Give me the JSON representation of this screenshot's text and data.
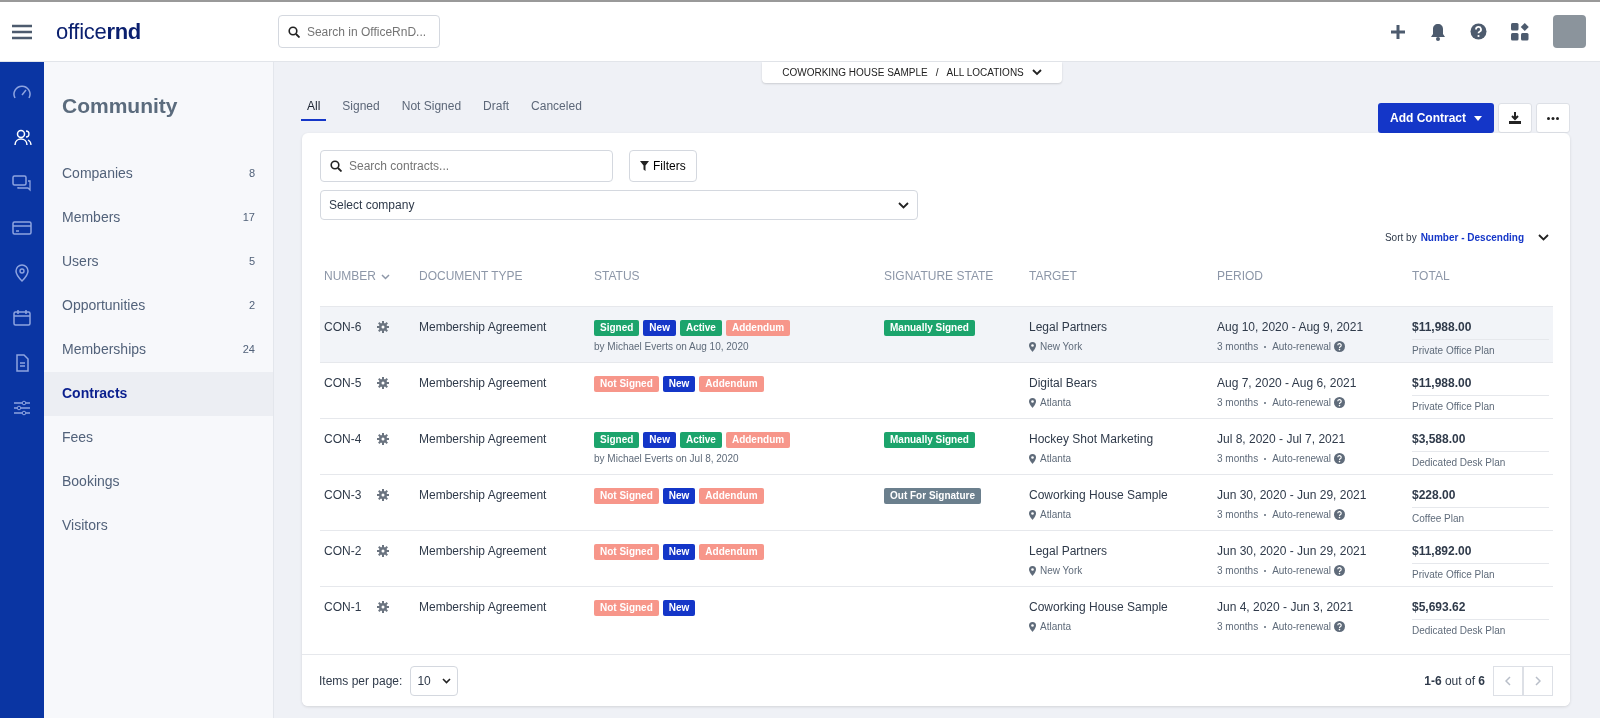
{
  "topbar": {
    "logo": {
      "light": "office",
      "bold": "rnd"
    },
    "search": {
      "placeholder": "Search in OfficeRnD..."
    }
  },
  "rail": [
    {
      "selected": false
    },
    {
      "selected": true
    },
    {
      "selected": false
    },
    {
      "selected": false
    },
    {
      "selected": false
    },
    {
      "selected": false
    },
    {
      "selected": false
    },
    {
      "selected": false
    }
  ],
  "sidebar": {
    "title": "Community",
    "items": [
      {
        "label": "Companies",
        "count": "8",
        "selected": false
      },
      {
        "label": "Members",
        "count": "17",
        "selected": false
      },
      {
        "label": "Users",
        "count": "5",
        "selected": false
      },
      {
        "label": "Opportunities",
        "count": "2",
        "selected": false
      },
      {
        "label": "Memberships",
        "count": "24",
        "selected": false
      },
      {
        "label": "Contracts",
        "selected": true
      },
      {
        "label": "Fees",
        "selected": false
      },
      {
        "label": "Bookings",
        "selected": false
      },
      {
        "label": "Visitors",
        "selected": false
      }
    ]
  },
  "location": {
    "company": "COWORKING HOUSE SAMPLE",
    "separator": "/",
    "scope": "ALL LOCATIONS"
  },
  "tabs": [
    {
      "label": "All",
      "selected": true
    },
    {
      "label": "Signed",
      "selected": false
    },
    {
      "label": "Not Signed",
      "selected": false
    },
    {
      "label": "Draft",
      "selected": false
    },
    {
      "label": "Canceled",
      "selected": false
    }
  ],
  "actions": {
    "add": "Add Contract"
  },
  "filters": {
    "search": {
      "placeholder": "Search contracts..."
    },
    "button": "Filters",
    "company": "Select company"
  },
  "sort": {
    "label": "Sort by",
    "value": "Number - Descending"
  },
  "table": {
    "columns": [
      "NUMBER",
      "DOCUMENT TYPE",
      "STATUS",
      "SIGNATURE STATE",
      "TARGET",
      "PERIOD",
      "TOTAL"
    ],
    "rows": [
      {
        "hovered": true,
        "number": "CON-6",
        "type": "Membership Agreement",
        "tags": [
          {
            "label": "Signed",
            "color": "#1ca46c"
          },
          {
            "label": "New",
            "color": "#1436c8"
          },
          {
            "label": "Active",
            "color": "#1ca46c"
          },
          {
            "label": "Addendum",
            "color": "#f7968a"
          }
        ],
        "signed_by": "by Michael Everts on Aug 10, 2020",
        "signature": {
          "label": "Manually Signed",
          "color": "#1ca46c"
        },
        "target": "Legal Partners",
        "location": "New York",
        "period": "Aug 10, 2020 - Aug 9, 2021",
        "duration": "3 months",
        "renewal": "Auto-renewal",
        "total": "$11,988.00",
        "plan": "Private Office Plan"
      },
      {
        "hovered": false,
        "number": "CON-5",
        "type": "Membership Agreement",
        "tags": [
          {
            "label": "Not Signed",
            "color": "#f7968a"
          },
          {
            "label": "New",
            "color": "#1436c8"
          },
          {
            "label": "Addendum",
            "color": "#f7968a"
          }
        ],
        "target": "Digital Bears",
        "location": "Atlanta",
        "period": "Aug 7, 2020 - Aug 6, 2021",
        "duration": "3 months",
        "renewal": "Auto-renewal",
        "total": "$11,988.00",
        "plan": "Private Office Plan"
      },
      {
        "hovered": false,
        "number": "CON-4",
        "type": "Membership Agreement",
        "tags": [
          {
            "label": "Signed",
            "color": "#1ca46c"
          },
          {
            "label": "New",
            "color": "#1436c8"
          },
          {
            "label": "Active",
            "color": "#1ca46c"
          },
          {
            "label": "Addendum",
            "color": "#f7968a"
          }
        ],
        "signed_by": "by Michael Everts on Jul 8, 2020",
        "signature": {
          "label": "Manually Signed",
          "color": "#1ca46c"
        },
        "target": "Hockey Shot Marketing",
        "location": "Atlanta",
        "period": "Jul 8, 2020 - Jul 7, 2021",
        "duration": "3 months",
        "renewal": "Auto-renewal",
        "total": "$3,588.00",
        "plan": "Dedicated Desk Plan"
      },
      {
        "hovered": false,
        "number": "CON-3",
        "type": "Membership Agreement",
        "tags": [
          {
            "label": "Not Signed",
            "color": "#f7968a"
          },
          {
            "label": "New",
            "color": "#1436c8"
          },
          {
            "label": "Addendum",
            "color": "#f7968a"
          }
        ],
        "signature": {
          "label": "Out For Signature",
          "color": "#6b7f8d"
        },
        "target": "Coworking House Sample",
        "location": "Atlanta",
        "period": "Jun 30, 2020 - Jun 29, 2021",
        "duration": "3 months",
        "renewal": "Auto-renewal",
        "total": "$228.00",
        "plan": "Coffee Plan"
      },
      {
        "hovered": false,
        "number": "CON-2",
        "type": "Membership Agreement",
        "tags": [
          {
            "label": "Not Signed",
            "color": "#f7968a"
          },
          {
            "label": "New",
            "color": "#1436c8"
          },
          {
            "label": "Addendum",
            "color": "#f7968a"
          }
        ],
        "target": "Legal Partners",
        "location": "New York",
        "period": "Jun 30, 2020 - Jun 29, 2021",
        "duration": "3 months",
        "renewal": "Auto-renewal",
        "total": "$11,892.00",
        "plan": "Private Office Plan"
      },
      {
        "hovered": false,
        "number": "CON-1",
        "type": "Membership Agreement",
        "tags": [
          {
            "label": "Not Signed",
            "color": "#f7968a"
          },
          {
            "label": "New",
            "color": "#1436c8"
          }
        ],
        "target": "Coworking House Sample",
        "location": "Atlanta",
        "period": "Jun 4, 2020 - Jun 3, 2021",
        "duration": "3 months",
        "renewal": "Auto-renewal",
        "total": "$5,693.62",
        "plan": "Dedicated Desk Plan"
      }
    ]
  },
  "footer": {
    "per_page_label": "Items per page:",
    "per_page": "10",
    "range": "**1-6** out of **6**",
    "prev_disabled": true,
    "next_disabled": true
  }
}
